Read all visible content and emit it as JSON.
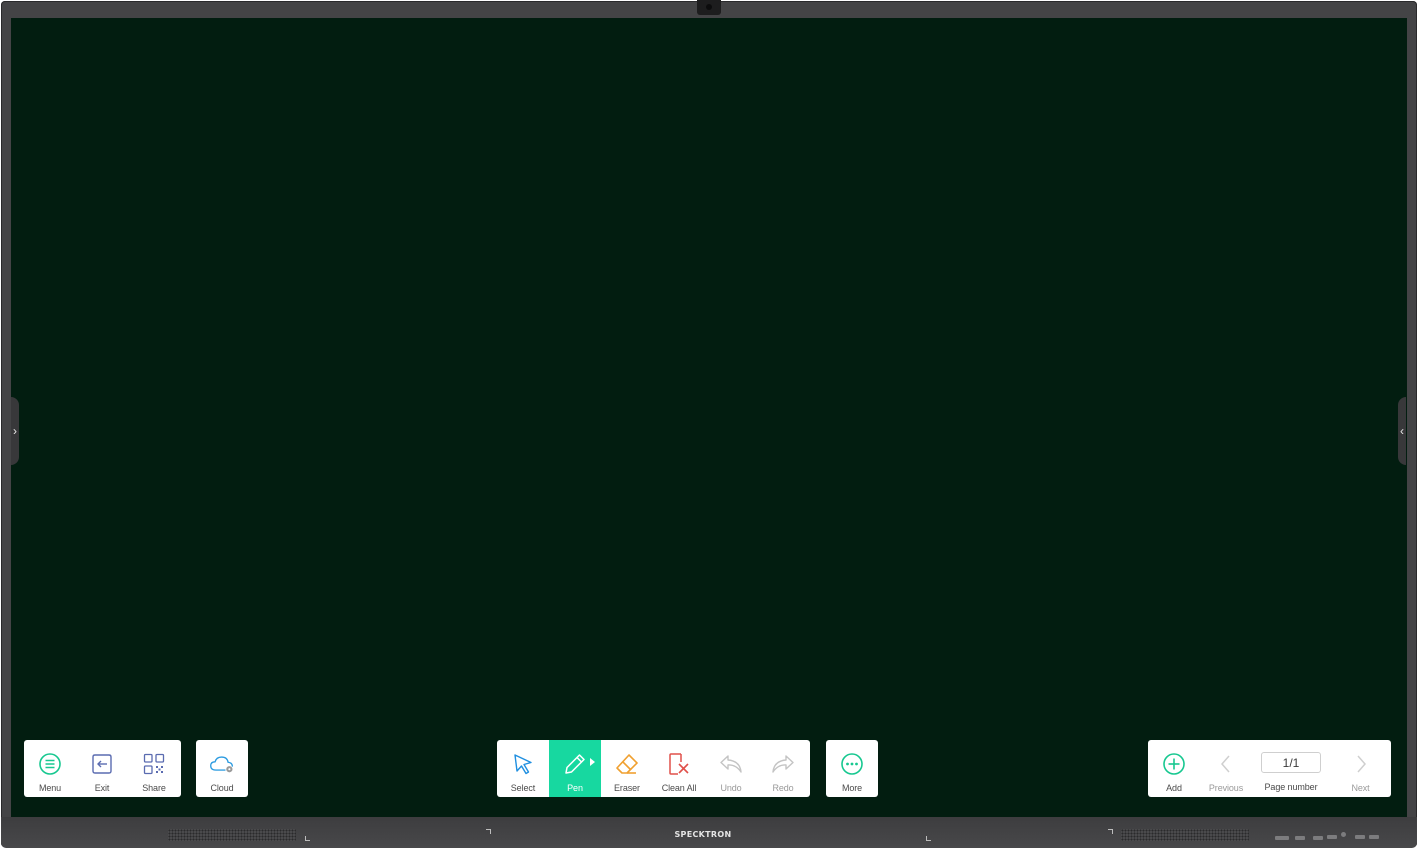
{
  "device": {
    "brand": "SPECKTRON"
  },
  "colors": {
    "board_background": "#021d10",
    "accent": "#17d8a0",
    "select_icon": "#1f8fe0",
    "eraser_icon": "#f0a030",
    "clean_all_icon": "#e0504a"
  },
  "edge_handles": {
    "left": "›",
    "right": "‹"
  },
  "toolbar_left": {
    "menu": {
      "label": "Menu",
      "icon": "menu-icon"
    },
    "exit": {
      "label": "Exit",
      "icon": "exit-icon"
    },
    "share": {
      "label": "Share",
      "icon": "qr-code-icon"
    }
  },
  "cloud": {
    "label": "Cloud",
    "icon": "cloud-icon"
  },
  "toolbar_center": {
    "select": {
      "label": "Select",
      "icon": "cursor-icon"
    },
    "pen": {
      "label": "Pen",
      "icon": "pen-icon",
      "active": true
    },
    "eraser": {
      "label": "Eraser",
      "icon": "eraser-icon"
    },
    "clean_all": {
      "label": "Clean All",
      "icon": "clean-all-icon"
    },
    "undo": {
      "label": "Undo",
      "icon": "undo-icon",
      "enabled": false
    },
    "redo": {
      "label": "Redo",
      "icon": "redo-icon",
      "enabled": false
    }
  },
  "more": {
    "label": "More",
    "icon": "more-icon"
  },
  "pager": {
    "add": {
      "label": "Add",
      "icon": "add-icon"
    },
    "previous": {
      "label": "Previous",
      "icon": "chevron-left-icon",
      "enabled": false
    },
    "page_value": "1/1",
    "page_label": "Page number",
    "next": {
      "label": "Next",
      "icon": "chevron-right-icon",
      "enabled": false
    }
  }
}
